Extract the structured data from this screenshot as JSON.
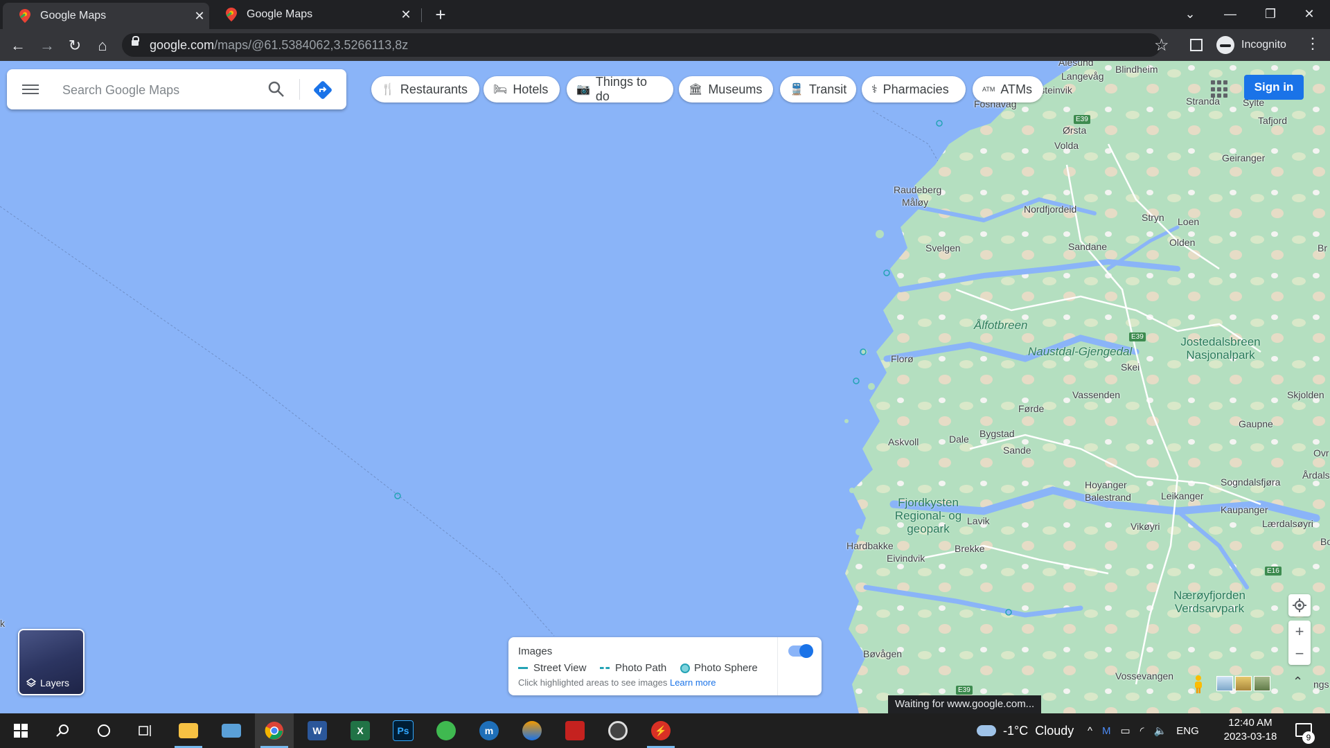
{
  "browser": {
    "tabs": [
      {
        "title": "Google Maps",
        "active": true
      },
      {
        "title": "Google Maps",
        "active": false
      }
    ],
    "new_tab_icon": "+",
    "url_host": "google.com",
    "url_path": "/maps/@61.5384062,3.5266113,8z",
    "profile_label": "Incognito"
  },
  "search": {
    "placeholder": "Search Google Maps"
  },
  "chips": [
    {
      "label": "Restaurants",
      "icon": "fork-knife-icon"
    },
    {
      "label": "Hotels",
      "icon": "bed-icon"
    },
    {
      "label": "Things to do",
      "icon": "camera-icon"
    },
    {
      "label": "Museums",
      "icon": "museum-icon"
    },
    {
      "label": "Transit",
      "icon": "train-icon"
    },
    {
      "label": "Pharmacies",
      "icon": "pharmacy-icon"
    },
    {
      "label": "ATMs",
      "icon": "atm-icon"
    }
  ],
  "chip_icon_glyphs": [
    "🍴",
    "🛏",
    "📷",
    "🏛",
    "🚆",
    "⚕",
    "ATM"
  ],
  "header": {
    "sign_in": "Sign in"
  },
  "layers": {
    "label": "Layers"
  },
  "images_panel": {
    "title": "Images",
    "legend": [
      "Street View",
      "Photo Path",
      "Photo Sphere"
    ],
    "hint": "Click highlighted areas to see images",
    "learn_more": "Learn more",
    "enabled": true
  },
  "map": {
    "places": [
      "Ålesund",
      "Blindheim",
      "Langevåg",
      "Ulsteinvik",
      "Fosnavåg",
      "Stranda",
      "Sylte",
      "Tafjord",
      "Ørsta",
      "Volda",
      "Geiranger",
      "Raudeberg",
      "Måløy",
      "Nordfjordeid",
      "Stryn",
      "Loen",
      "Olden",
      "Svelgen",
      "Sandane",
      "Florø",
      "Skei",
      "Vassenden",
      "Førde",
      "Skjolden",
      "Gaupne",
      "Askvoll",
      "Dale",
      "Bygstad",
      "Sande",
      "Hoyanger",
      "Balestrand",
      "Leikanger",
      "Sogndalsfjøra",
      "Årdalst",
      "Kaupanger",
      "Lærdalsøyri",
      "Lavik",
      "Hardbakke",
      "Eivindvik",
      "Brekke",
      "Vikøyri",
      "Bøvågen",
      "Vossevangen",
      "Ovr",
      "Br",
      "Bo",
      "ngs",
      "k"
    ],
    "parks": [
      "Ålfotbreen",
      "Naustdal-Gjengedal",
      "Jostedalsbreen Nasjonalpark",
      "Fjordkysten Regional- og geopark",
      "Nærøyfjorden Verdsarvpark"
    ],
    "road_badges": [
      "E39",
      "E39",
      "E39",
      "E16"
    ],
    "colors": {
      "water": "#8ab4f8",
      "land": "#b8e0c4",
      "roads": "#ffffff"
    }
  },
  "map_controls": {
    "zoom_in": "+",
    "zoom_out": "−",
    "collapse": "⌃"
  },
  "status_text": "Waiting for www.google.com...",
  "taskbar": {
    "apps": [
      "start",
      "search",
      "cortana",
      "task-view",
      "file-explorer",
      "control-panel",
      "chrome",
      "word",
      "excel",
      "photoshop",
      "app-green",
      "app-blue",
      "app-color",
      "app-red",
      "app-music",
      "app-flash"
    ],
    "weather_temp": "-1°C",
    "weather_text": "Cloudy",
    "language": "ENG",
    "time": "12:40 AM",
    "date": "2023-03-18",
    "notification_count": "9"
  }
}
